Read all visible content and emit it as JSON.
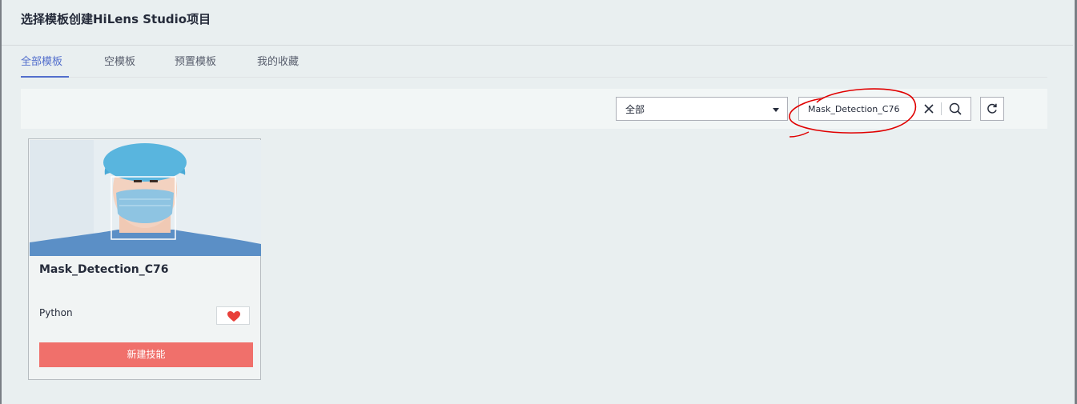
{
  "page_title": "选择模板创建HiLens Studio项目",
  "tabs": [
    {
      "label": "全部模板",
      "active": true
    },
    {
      "label": "空模板",
      "active": false
    },
    {
      "label": "预置模板",
      "active": false
    },
    {
      "label": "我的收藏",
      "active": false
    }
  ],
  "filter": {
    "category_select_value": "全部",
    "search_value": "Mask_Detection_C76"
  },
  "icons": {
    "select_caret": "caret-down-icon",
    "clear": "close-icon",
    "search": "search-icon",
    "refresh": "refresh-icon",
    "favorite": "heart-icon"
  },
  "templates": [
    {
      "name": "Mask_Detection_C76",
      "language": "Python",
      "favorited": true,
      "create_label": "新建技能"
    }
  ],
  "colors": {
    "accent": "#526ecc",
    "create_button": "#f0706b",
    "favorite_heart": "#e8403a",
    "annotation_circle": "#e00000"
  }
}
